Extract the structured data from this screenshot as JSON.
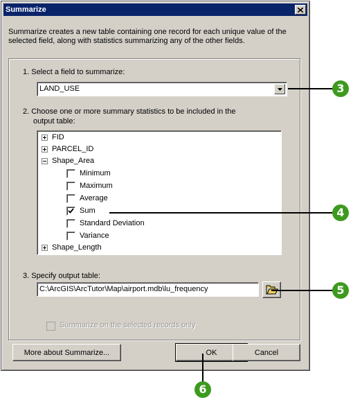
{
  "window": {
    "title": "Summarize",
    "close_glyph": "✕"
  },
  "description": "Summarize creates a new table containing one record for each unique value of the selected field, along with statistics summarizing any of the other fields.",
  "step1": {
    "label": "1.  Select a field to summarize:",
    "value": "LAND_USE"
  },
  "step2": {
    "label_line1": "2.  Choose one or more summary statistics to be included in the",
    "label_line2": "output table:",
    "fields": [
      {
        "name": "FID",
        "expanded": false
      },
      {
        "name": "PARCEL_ID",
        "expanded": false
      },
      {
        "name": "Shape_Area",
        "expanded": true
      },
      {
        "name": "Shape_Length",
        "expanded": false
      }
    ],
    "statistics": [
      {
        "label": "Minimum",
        "checked": false
      },
      {
        "label": "Maximum",
        "checked": false
      },
      {
        "label": "Average",
        "checked": false
      },
      {
        "label": "Sum",
        "checked": true
      },
      {
        "label": "Standard Deviation",
        "checked": false
      },
      {
        "label": "Variance",
        "checked": false
      }
    ]
  },
  "step3": {
    "label": "3.  Specify output table:",
    "value": "C:\\ArcGIS\\ArcTutor\\Map\\airport.mdb\\lu_frequency"
  },
  "selected_only": {
    "label": "Summarize on the selected records only",
    "enabled": false,
    "checked": false
  },
  "buttons": {
    "more": "More about Summarize...",
    "ok": "OK",
    "cancel": "Cancel"
  },
  "callouts": {
    "c3": "3",
    "c4": "4",
    "c5": "5",
    "c6": "6"
  },
  "colors": {
    "titlebar": "#0a246a",
    "callout": "#3d9a1f",
    "dialog": "#d4d0c8"
  },
  "icons": {
    "dropdown": "chevron-down-icon",
    "browse": "folder-open-icon",
    "check": "checkmark-icon"
  }
}
